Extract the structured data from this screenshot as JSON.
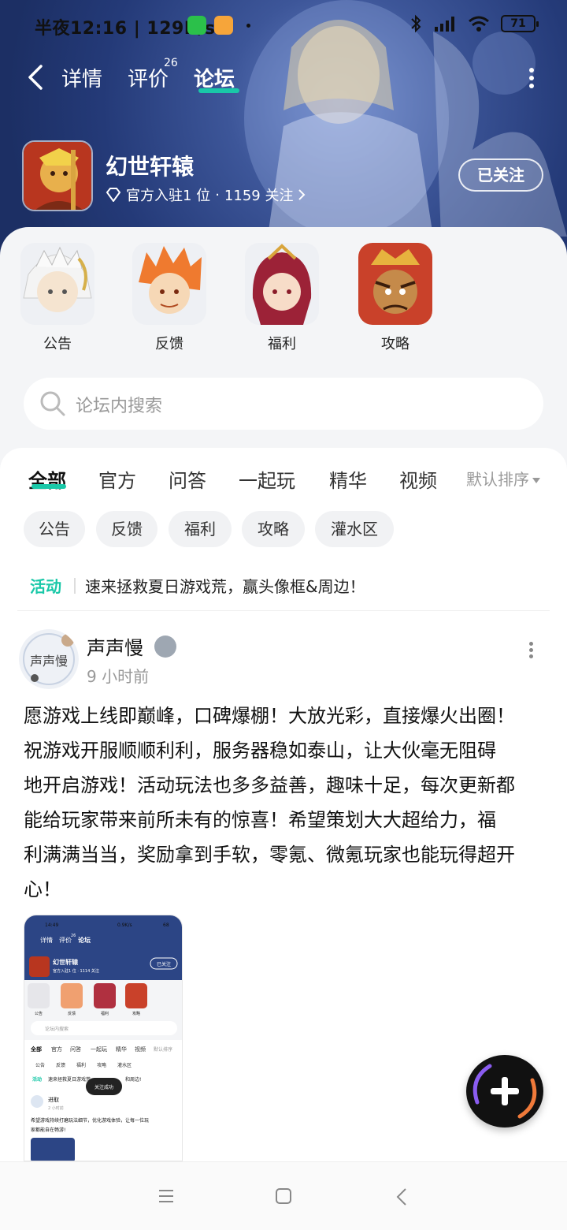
{
  "status_bar": {
    "text": "半夜12:16 | 129K/s",
    "battery": "71"
  },
  "nav": {
    "tabs": [
      {
        "label": "详情"
      },
      {
        "label": "评价"
      },
      {
        "label": "论坛"
      }
    ],
    "review_count": "26",
    "active_tab": "论坛"
  },
  "game": {
    "name": "幻世轩辕",
    "official_text": "官方入驻1 位",
    "followers_text": "1159 关注",
    "follow_button": "已关注"
  },
  "quick_links": [
    {
      "label": "公告"
    },
    {
      "label": "反馈"
    },
    {
      "label": "福利"
    },
    {
      "label": "攻略"
    }
  ],
  "search": {
    "placeholder": "论坛内搜索"
  },
  "feed_tabs": [
    {
      "label": "全部"
    },
    {
      "label": "官方"
    },
    {
      "label": "问答"
    },
    {
      "label": "一起玩"
    },
    {
      "label": "精华"
    },
    {
      "label": "视频"
    }
  ],
  "sort_label": "默认排序",
  "chips": [
    {
      "label": "公告"
    },
    {
      "label": "反馈"
    },
    {
      "label": "福利"
    },
    {
      "label": "攻略"
    },
    {
      "label": "灌水区"
    }
  ],
  "activity": {
    "tag": "活动",
    "text": "速来拯救夏日游戏荒，赢头像框&周边！"
  },
  "post": {
    "avatar_text": "声声慢",
    "username": "声声慢",
    "time": "9 小时前",
    "lines": [
      "愿游戏上线即巅峰，口碑爆棚！大放光彩，直接爆火出圈！",
      "祝游戏开服顺顺利利，服务器稳如泰山，让大伙毫无阻碍",
      "地开启游戏！活动玩法也多多益善，趣味十足，每次更新都",
      "能给玩家带来前所未有的惊喜！希望策划大大超给力，福",
      "利满满当当，奖励拿到手软，零氪、微氪玩家也能玩得超开",
      "心！"
    ]
  },
  "thumb": {
    "time": "14:49",
    "speed": "0.9K/s",
    "battery": "68",
    "tabs": [
      "详情",
      "评价",
      "论坛"
    ],
    "review_count": "26",
    "game_name": "幻世轩辕",
    "game_meta": "官方入驻1 位 · 1114 关注",
    "follow_button": "已关注",
    "quick": [
      "公告",
      "反馈",
      "福利",
      "攻略"
    ],
    "search_placeholder": "论坛内搜索",
    "feed_tabs": [
      "全部",
      "官方",
      "问答",
      "一起玩",
      "精华",
      "视频"
    ],
    "sort_label": "默认排序",
    "chips": [
      "公告",
      "反馈",
      "福利",
      "攻略",
      "灌水区"
    ],
    "activity_tag": "活动",
    "activity_text": "速来拯救夏日游戏荒",
    "toast": "关注成功",
    "activity_tail": "和周边!",
    "post_user": "进取",
    "post_time": "2 小时前",
    "post_line1": "希望游戏持续打磨玩法细节，优化游戏体验，让每一位玩",
    "post_line2": "家都能自在畅游!"
  },
  "colors": {
    "accent": "#19c8a8",
    "header_dark": "#1c2f64",
    "header_light": "#6b86c8"
  },
  "icons": [
    "back-arrow-icon",
    "more-vertical-icon",
    "diamond-icon",
    "chevron-right-icon",
    "search-icon",
    "plus-icon",
    "menu-icon",
    "home-square-icon",
    "back-triangle-icon"
  ]
}
